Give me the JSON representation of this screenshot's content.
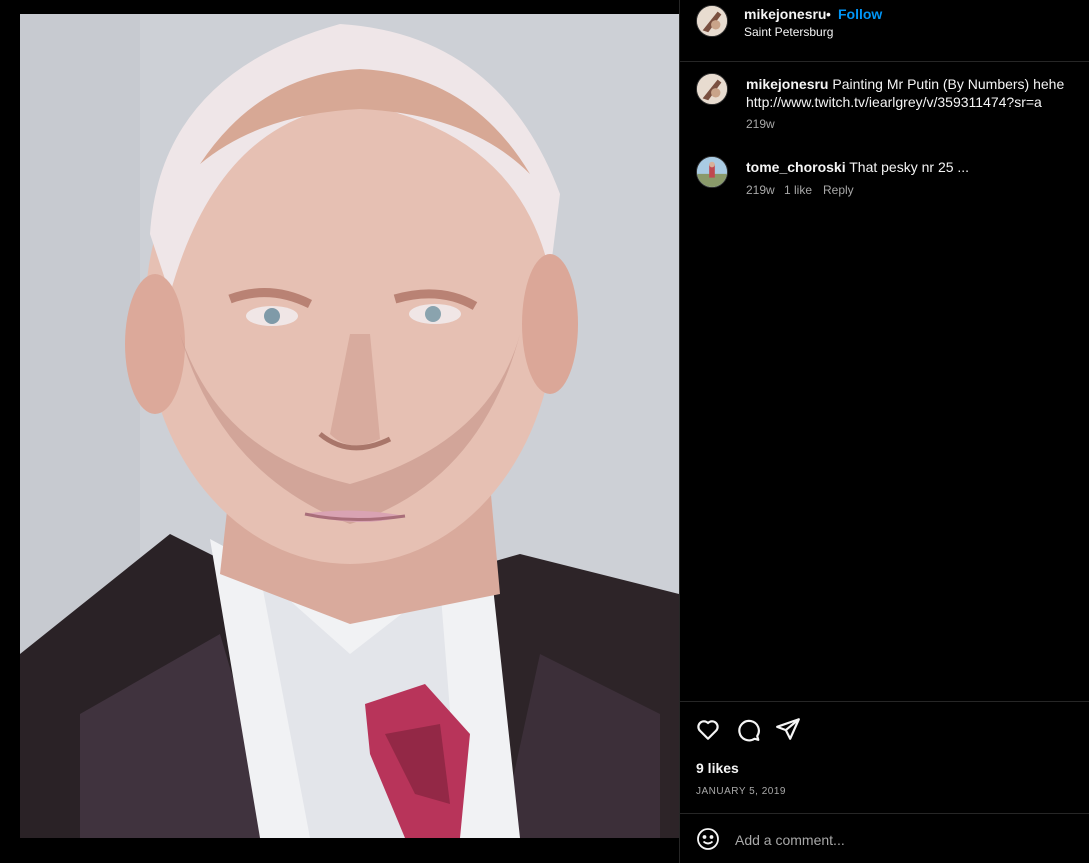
{
  "post": {
    "author": "mikejonesru",
    "separator": "•",
    "follow_label": "Follow",
    "location": "Saint Petersburg"
  },
  "caption": {
    "author": "mikejonesru",
    "text_line1": "Painting Mr Putin (By Numbers) hehe",
    "text_line2": "http://www.twitch.tv/iearlgrey/v/359311474?sr=a",
    "age": "219w"
  },
  "comments": [
    {
      "author": "tome_choroski",
      "text": "That pesky nr 25 ...",
      "age": "219w",
      "likes": "1 like",
      "reply_label": "Reply"
    }
  ],
  "actions": {
    "like_icon": "heart-icon",
    "comment_icon": "comment-icon",
    "share_icon": "share-icon"
  },
  "likes_text": "9 likes",
  "date_text": "JANUARY 5, 2019",
  "add_comment": {
    "placeholder": "Add a comment...",
    "emoji_icon": "smiley-icon"
  },
  "colors": {
    "background": "#000000",
    "text": "#f5f5f5",
    "muted": "#a8a8a8",
    "accent": "#0095f6",
    "divider": "#262626"
  }
}
